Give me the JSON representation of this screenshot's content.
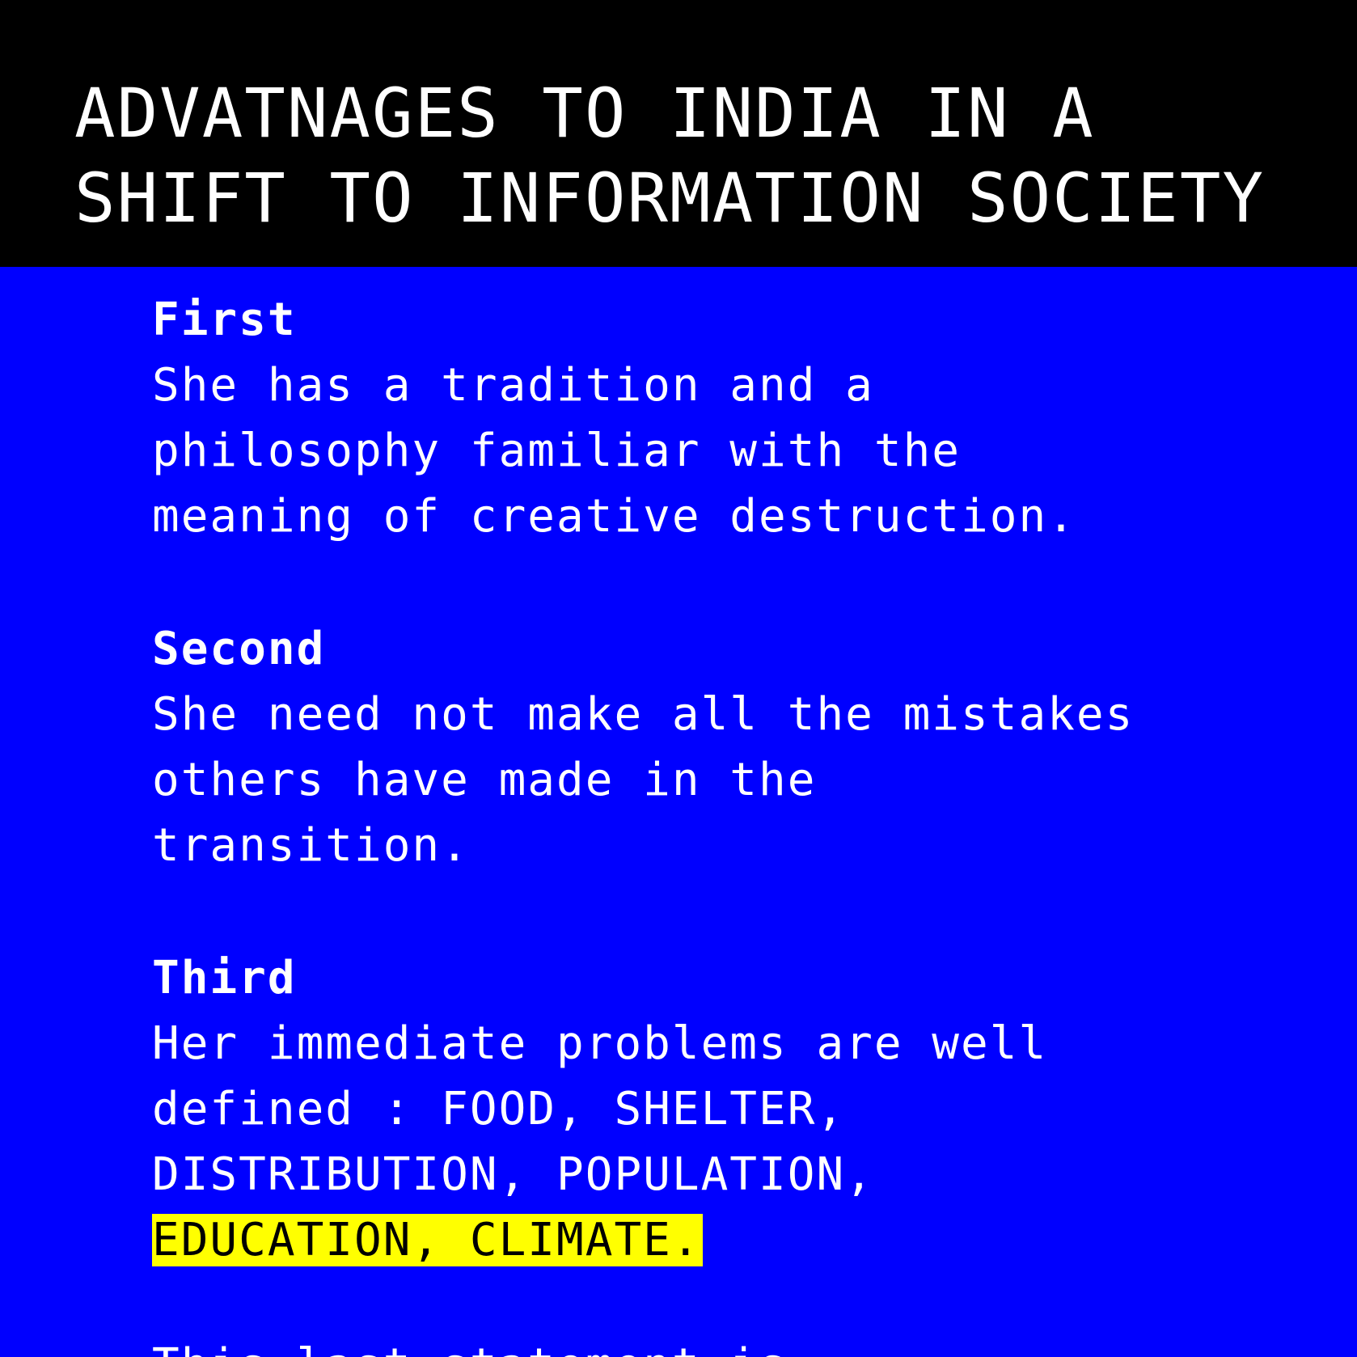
{
  "header": {
    "title_lines": [
      "ADVATNAGES TO INDIA IN A",
      "SHIFT TO INFORMATION SOCIETY"
    ]
  },
  "sections": [
    {
      "heading": "First",
      "lines": [
        "She has a tradition and a",
        "philosophy familiar with the",
        "meaning of creative destruction."
      ]
    },
    {
      "heading": "Second",
      "lines": [
        "She need not make all the mistakes",
        "others have made in the",
        "transition."
      ]
    },
    {
      "heading": "Third",
      "lines": [
        "Her immediate problems are well",
        "defined : FOOD, SHELTER,",
        "DISTRIBUTION, POPULATION,"
      ],
      "highlighted_line": "EDUCATION, CLIMATE."
    }
  ],
  "footer": {
    "cut_off_line": "This last statement is"
  },
  "colors": {
    "background": "#0000ff",
    "header_background": "#000000",
    "text": "#ffffff",
    "highlight": "#ffff00",
    "highlight_text": "#000000"
  }
}
